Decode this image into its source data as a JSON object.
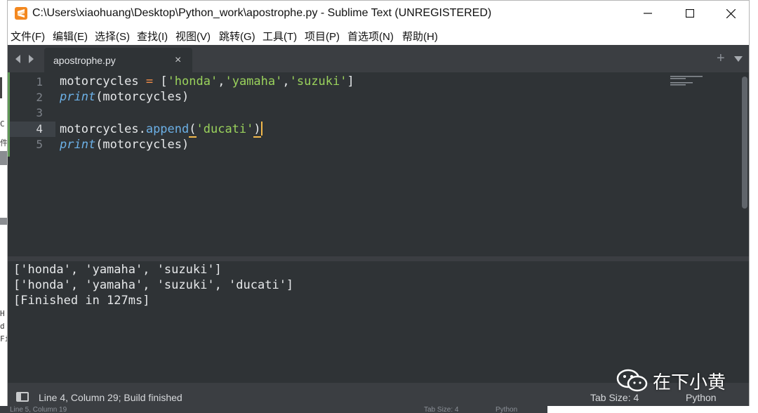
{
  "window": {
    "title": "C:\\Users\\xiaohuang\\Desktop\\Python_work\\apostrophe.py - Sublime Text (UNREGISTERED)"
  },
  "menu": [
    "文件(F)",
    "编辑(E)",
    "选择(S)",
    "查找(I)",
    "视图(V)",
    "跳转(G)",
    "工具(T)",
    "项目(P)",
    "首选项(N)",
    "帮助(H)"
  ],
  "tab": {
    "label": "apostrophe.py",
    "close": "×"
  },
  "editor": {
    "line_numbers": [
      "1",
      "2",
      "3",
      "4",
      "5"
    ],
    "current_line": 4
  },
  "output": {
    "lines": [
      "['honda', 'yamaha', 'suzuki']",
      "['honda', 'yamaha', 'suzuki', 'ducati']",
      "[Finished in 127ms]"
    ]
  },
  "status": {
    "position": "Line 4, Column 29; Build finished",
    "tab_size": "Tab Size: 4",
    "syntax": "Python"
  },
  "watermark": {
    "text": "在下小黄",
    "icon": "wechat-icon"
  },
  "background": {
    "bottom_texts": [
      "Line 5, Column 19",
      "Tab Size: 4",
      "Python"
    ]
  },
  "colors": {
    "editor_bg": "#2f3336",
    "chrome_bg": "#3b3e42",
    "string": "#9ad25c",
    "operator": "#f08d49",
    "function": "#6cb0e6",
    "cursor": "#f2b84b"
  }
}
